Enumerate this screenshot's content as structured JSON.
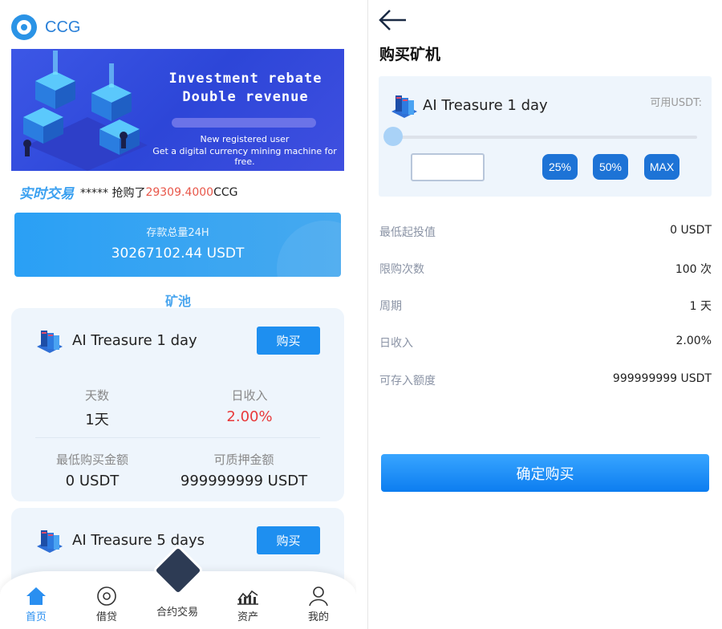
{
  "left": {
    "app_title": "CCG",
    "banner": {
      "headline1": "Investment rebate",
      "headline2": "Double revenue",
      "line1": "New registered user",
      "line2": "Get a digital currency mining machine for free."
    },
    "ticker": {
      "tag": "实时交易",
      "user": "***** 抢购了",
      "amount": "29309.4000",
      "unit": "CCG"
    },
    "deposit": {
      "label": "存款总量24H",
      "value": "30267102.44 USDT"
    },
    "pool_title": "矿池",
    "cards": [
      {
        "name": "AI Treasure 1 day",
        "buy_label": "购买",
        "days_label": "天数",
        "days_value": "1天",
        "daily_label": "日收入",
        "daily_value": "2.00%",
        "min_label": "最低购买金额",
        "min_value": "0 USDT",
        "pledge_label": "可质押金额",
        "pledge_value": "999999999 USDT"
      },
      {
        "name": "AI Treasure 5 days",
        "buy_label": "购买"
      }
    ],
    "tabs": [
      {
        "label": "首页",
        "icon": "home-icon"
      },
      {
        "label": "借贷",
        "icon": "coin-icon"
      },
      {
        "label": "合约交易",
        "icon": "diamond-icon"
      },
      {
        "label": "资产",
        "icon": "chart-icon"
      },
      {
        "label": "我的",
        "icon": "user-icon"
      }
    ]
  },
  "right": {
    "title": "购买矿机",
    "product_name": "AI Treasure 1 day",
    "available_label": "可用USDT:",
    "slider_value": 0,
    "quantity_value": "",
    "pct_buttons": [
      "25%",
      "50%",
      "MAX"
    ],
    "details": [
      {
        "key": "最低起投值",
        "value": "0 USDT"
      },
      {
        "key": "限购次数",
        "value": "100 次"
      },
      {
        "key": "周期",
        "value": "1 天"
      },
      {
        "key": "日收入",
        "value": "2.00%"
      },
      {
        "key": "可存入额度",
        "value": "999999999 USDT"
      }
    ],
    "confirm_label": "确定购买"
  },
  "colors": {
    "accent": "#1e8ff0",
    "pct_button": "#1d73d6",
    "card_bg": "#eef5fc",
    "red": "#e8393a"
  }
}
